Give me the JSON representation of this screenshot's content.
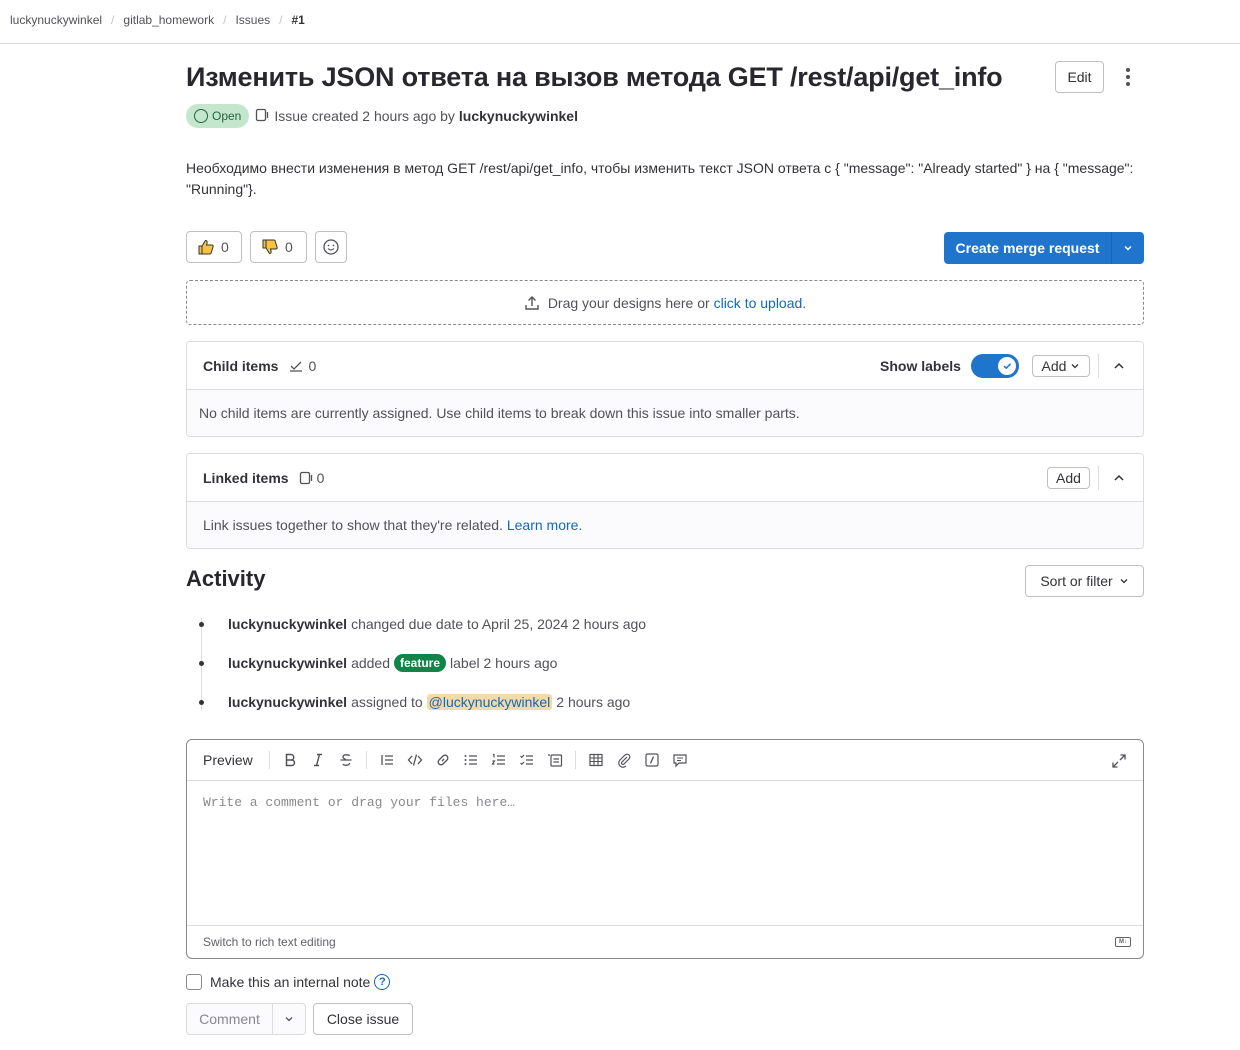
{
  "breadcrumb": {
    "items": [
      "luckynuckywinkel",
      "gitlab_homework",
      "Issues",
      "#1"
    ]
  },
  "issue": {
    "title": "Изменить JSON ответа на вызов метода GET /rest/api/get_info",
    "edit_label": "Edit",
    "status": "Open",
    "created_text": "Issue created 2 hours ago by",
    "author": "luckynuckywinkel",
    "description": "Необходимо внести изменения в метод GET /rest/api/get_info, чтобы изменить текст JSON ответа с { \"message\": \"Already started\" } на { \"message\": \"Running\"}."
  },
  "reactions": {
    "thumbs_up": "0",
    "thumbs_down": "0"
  },
  "merge_request": {
    "label": "Create merge request"
  },
  "upload": {
    "text": "Drag your designs here or",
    "link": "click to upload",
    "suffix": "."
  },
  "child_items": {
    "title": "Child items",
    "count": "0",
    "show_labels": "Show labels",
    "add_label": "Add",
    "empty_text": "No child items are currently assigned. Use child items to break down this issue into smaller parts."
  },
  "linked_items": {
    "title": "Linked items",
    "count": "0",
    "add_label": "Add",
    "empty_text": "Link issues together to show that they're related.",
    "learn_more": "Learn more."
  },
  "activity": {
    "title": "Activity",
    "sort_label": "Sort or filter",
    "items": [
      {
        "user": "luckynuckywinkel",
        "text": "changed due date to April 25, 2024 2 hours ago"
      },
      {
        "user": "luckynuckywinkel",
        "before": "added",
        "label": "feature",
        "after": "label 2 hours ago"
      },
      {
        "user": "luckynuckywinkel",
        "before": "assigned to",
        "mention": "@luckynuckywinkel",
        "after": "2 hours ago"
      }
    ]
  },
  "editor": {
    "preview_label": "Preview",
    "placeholder": "Write a comment or drag your files here…",
    "switch_label": "Switch to rich text editing",
    "toolbar_icons": [
      "bold-icon",
      "italic-icon",
      "strikethrough-icon",
      "quote-icon",
      "code-icon",
      "link-icon",
      "bullet-list-icon",
      "numbered-list-icon",
      "task-list-icon",
      "collapsible-section-icon",
      "table-icon",
      "attach-file-icon",
      "slash-commands-icon",
      "comment-icon",
      "fullscreen-icon"
    ]
  },
  "footer": {
    "internal_note_label": "Make this an internal note",
    "comment_label": "Comment",
    "close_issue_label": "Close issue"
  },
  "colors": {
    "accent": "#1f75cb",
    "label_feature": "#108548",
    "open_badge_bg": "#c3e6cd",
    "mention_bg": "#f5d9a8"
  }
}
